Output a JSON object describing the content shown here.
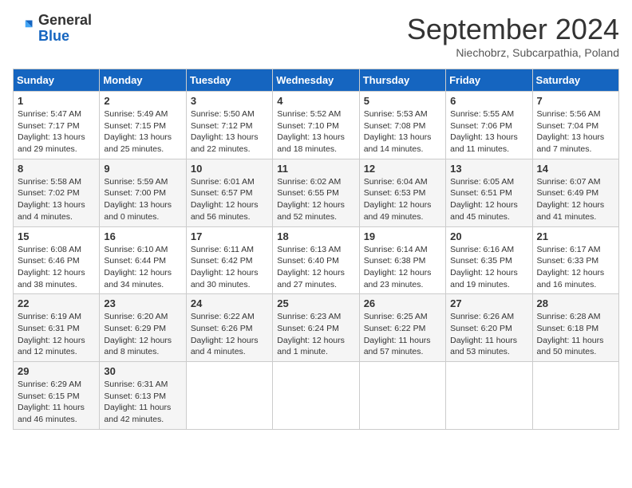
{
  "header": {
    "logo_general": "General",
    "logo_blue": "Blue",
    "month_title": "September 2024",
    "location": "Niechobrz, Subcarpathia, Poland"
  },
  "weekdays": [
    "Sunday",
    "Monday",
    "Tuesday",
    "Wednesday",
    "Thursday",
    "Friday",
    "Saturday"
  ],
  "weeks": [
    [
      {
        "day": "1",
        "sunrise": "5:47 AM",
        "sunset": "7:17 PM",
        "daylight": "13 hours and 29 minutes."
      },
      {
        "day": "2",
        "sunrise": "5:49 AM",
        "sunset": "7:15 PM",
        "daylight": "13 hours and 25 minutes."
      },
      {
        "day": "3",
        "sunrise": "5:50 AM",
        "sunset": "7:12 PM",
        "daylight": "13 hours and 22 minutes."
      },
      {
        "day": "4",
        "sunrise": "5:52 AM",
        "sunset": "7:10 PM",
        "daylight": "13 hours and 18 minutes."
      },
      {
        "day": "5",
        "sunrise": "5:53 AM",
        "sunset": "7:08 PM",
        "daylight": "13 hours and 14 minutes."
      },
      {
        "day": "6",
        "sunrise": "5:55 AM",
        "sunset": "7:06 PM",
        "daylight": "13 hours and 11 minutes."
      },
      {
        "day": "7",
        "sunrise": "5:56 AM",
        "sunset": "7:04 PM",
        "daylight": "13 hours and 7 minutes."
      }
    ],
    [
      {
        "day": "8",
        "sunrise": "5:58 AM",
        "sunset": "7:02 PM",
        "daylight": "13 hours and 4 minutes."
      },
      {
        "day": "9",
        "sunrise": "5:59 AM",
        "sunset": "7:00 PM",
        "daylight": "13 hours and 0 minutes."
      },
      {
        "day": "10",
        "sunrise": "6:01 AM",
        "sunset": "6:57 PM",
        "daylight": "12 hours and 56 minutes."
      },
      {
        "day": "11",
        "sunrise": "6:02 AM",
        "sunset": "6:55 PM",
        "daylight": "12 hours and 52 minutes."
      },
      {
        "day": "12",
        "sunrise": "6:04 AM",
        "sunset": "6:53 PM",
        "daylight": "12 hours and 49 minutes."
      },
      {
        "day": "13",
        "sunrise": "6:05 AM",
        "sunset": "6:51 PM",
        "daylight": "12 hours and 45 minutes."
      },
      {
        "day": "14",
        "sunrise": "6:07 AM",
        "sunset": "6:49 PM",
        "daylight": "12 hours and 41 minutes."
      }
    ],
    [
      {
        "day": "15",
        "sunrise": "6:08 AM",
        "sunset": "6:46 PM",
        "daylight": "12 hours and 38 minutes."
      },
      {
        "day": "16",
        "sunrise": "6:10 AM",
        "sunset": "6:44 PM",
        "daylight": "12 hours and 34 minutes."
      },
      {
        "day": "17",
        "sunrise": "6:11 AM",
        "sunset": "6:42 PM",
        "daylight": "12 hours and 30 minutes."
      },
      {
        "day": "18",
        "sunrise": "6:13 AM",
        "sunset": "6:40 PM",
        "daylight": "12 hours and 27 minutes."
      },
      {
        "day": "19",
        "sunrise": "6:14 AM",
        "sunset": "6:38 PM",
        "daylight": "12 hours and 23 minutes."
      },
      {
        "day": "20",
        "sunrise": "6:16 AM",
        "sunset": "6:35 PM",
        "daylight": "12 hours and 19 minutes."
      },
      {
        "day": "21",
        "sunrise": "6:17 AM",
        "sunset": "6:33 PM",
        "daylight": "12 hours and 16 minutes."
      }
    ],
    [
      {
        "day": "22",
        "sunrise": "6:19 AM",
        "sunset": "6:31 PM",
        "daylight": "12 hours and 12 minutes."
      },
      {
        "day": "23",
        "sunrise": "6:20 AM",
        "sunset": "6:29 PM",
        "daylight": "12 hours and 8 minutes."
      },
      {
        "day": "24",
        "sunrise": "6:22 AM",
        "sunset": "6:26 PM",
        "daylight": "12 hours and 4 minutes."
      },
      {
        "day": "25",
        "sunrise": "6:23 AM",
        "sunset": "6:24 PM",
        "daylight": "12 hours and 1 minute."
      },
      {
        "day": "26",
        "sunrise": "6:25 AM",
        "sunset": "6:22 PM",
        "daylight": "11 hours and 57 minutes."
      },
      {
        "day": "27",
        "sunrise": "6:26 AM",
        "sunset": "6:20 PM",
        "daylight": "11 hours and 53 minutes."
      },
      {
        "day": "28",
        "sunrise": "6:28 AM",
        "sunset": "6:18 PM",
        "daylight": "11 hours and 50 minutes."
      }
    ],
    [
      {
        "day": "29",
        "sunrise": "6:29 AM",
        "sunset": "6:15 PM",
        "daylight": "11 hours and 46 minutes."
      },
      {
        "day": "30",
        "sunrise": "6:31 AM",
        "sunset": "6:13 PM",
        "daylight": "11 hours and 42 minutes."
      },
      null,
      null,
      null,
      null,
      null
    ]
  ],
  "labels": {
    "sunrise": "Sunrise:",
    "sunset": "Sunset:",
    "daylight": "Daylight:"
  }
}
